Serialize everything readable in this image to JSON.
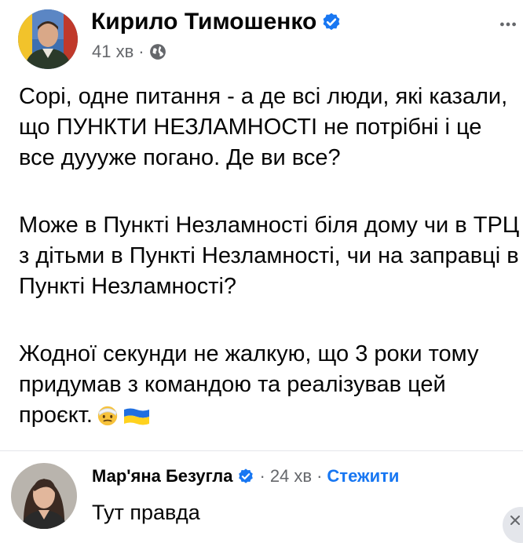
{
  "post": {
    "author": "Кирило Тимошенко",
    "time": "41 хв",
    "separator": "·",
    "privacy_icon": "globe-icon",
    "paragraphs": [
      "Сорі, одне питання - а де всі люди, які казали, що ПУНКТИ НЕЗЛАМНОСТІ не потрібні і це все дуууже погано. Де ви все?",
      "Може в Пункті Незламності біля дому чи в ТРЦ з дітьми в Пункті Незламності, чи на заправці в Пункті Незламності?",
      "Жодної секунди не жалкую, що 3 роки тому придумав з командою та реалізував цей проєкт."
    ],
    "emojis": [
      "face-with-bandage-emoji",
      "ukraine-flag-emoji"
    ]
  },
  "comment": {
    "author": "Мар'яна Безугла",
    "time": "24 хв",
    "separator": "·",
    "follow_label": "Стежити",
    "text": "Тут правда"
  },
  "colors": {
    "text": "#050505",
    "secondary": "#65676b",
    "link": "#1877f2",
    "verified": "#1877f2",
    "divider": "#e4e6eb"
  }
}
